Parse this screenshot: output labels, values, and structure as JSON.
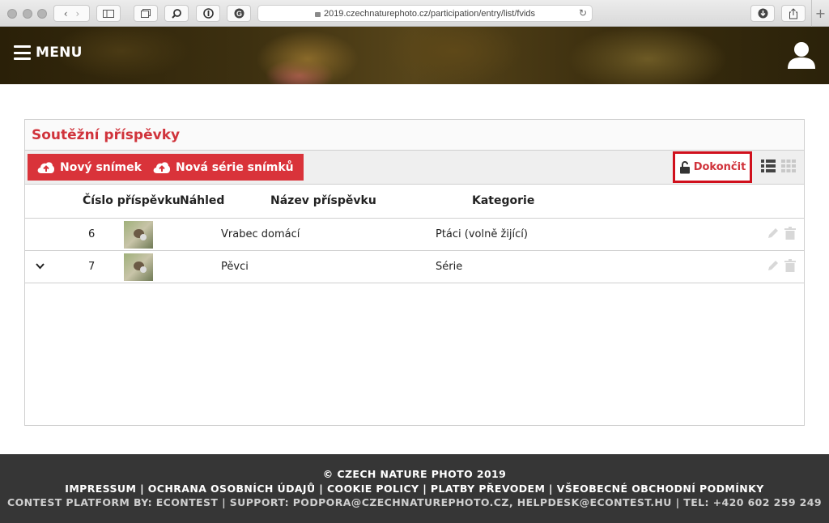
{
  "browser": {
    "url": "2019.czechnaturephoto.cz/participation/entry/list/fvids"
  },
  "header": {
    "menu_label": "MENU"
  },
  "panel": {
    "title": "Soutěžní příspěvky",
    "new_photo_label": "Nový snímek",
    "new_series_label": "Nová série snímků",
    "finish_label": "Dokončit"
  },
  "table": {
    "columns": [
      "Číslo příspěvku",
      "Náhled",
      "Název příspěvku",
      "Kategorie"
    ],
    "rows": [
      {
        "number": "6",
        "name": "Vrabec domácí",
        "category": "Ptáci (volně žijící)",
        "expandable": false
      },
      {
        "number": "7",
        "name": "Pěvci",
        "category": "Série",
        "expandable": true
      }
    ]
  },
  "footer": {
    "copyright": "© CZECH NATURE PHOTO 2019",
    "links": "IMPRESSUM | OCHRANA OSOBNÍCH ÚDAJŮ | COOKIE POLICY | PLATBY PŘEVODEM | VŠEOBECNÉ OBCHODNÍ PODMÍNKY",
    "platform": "CONTEST PLATFORM BY: ECONTEST | SUPPORT: PODPORA@CZECHNATUREPHOTO.CZ, HELPDESK@ECONTEST.HU | TEL: +420 602 259 249"
  },
  "colors": {
    "accent": "#d9333a",
    "title": "#d0333b",
    "highlight_border": "#d0101c",
    "footer_bg": "#363636"
  },
  "icons": [
    "back-icon",
    "forward-icon",
    "sidebar-icon",
    "tabs-icon",
    "search-icon",
    "privacy-icon",
    "grammarly-icon",
    "reload-icon",
    "download-icon",
    "share-icon",
    "hamburger-icon",
    "user-icon",
    "cloud-upload-icon",
    "unlock-icon",
    "list-view-icon",
    "grid-view-icon",
    "chevron-down-icon",
    "pencil-icon",
    "trash-icon"
  ]
}
